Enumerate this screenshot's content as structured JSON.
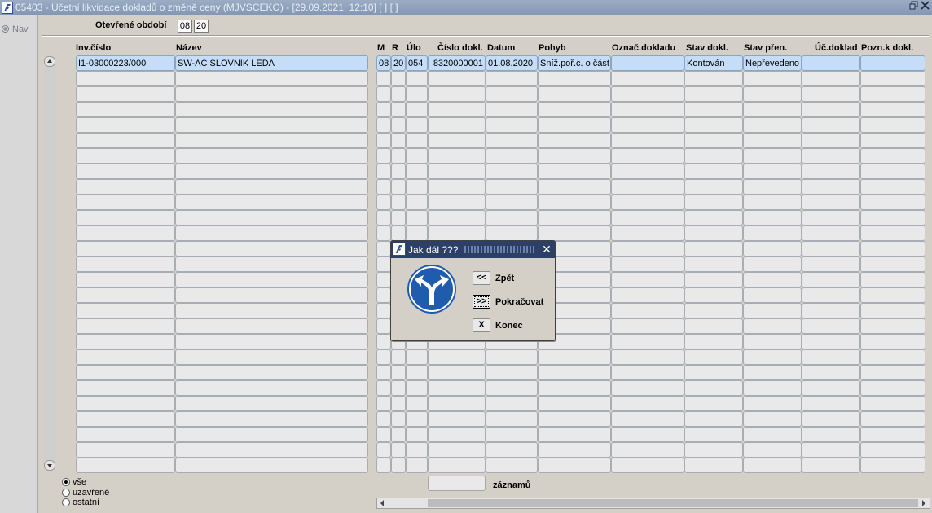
{
  "window": {
    "title": "05403 - Účetní likvidace dokladů o změně ceny (MJVSCEKO) - [29.09.2021; 12:10]  [ ]  [ ]"
  },
  "nav": {
    "label": "Nav"
  },
  "period": {
    "label": "Otevřené období",
    "month": "08",
    "year": "20"
  },
  "table": {
    "headers": [
      "Inv.číslo",
      "Název",
      "M",
      "R",
      "Úlo",
      "Číslo dokl.",
      "Datum",
      "Pohyb",
      "Označ.dokladu",
      "Stav dokl.",
      "Stav přen.",
      "Úč.doklad",
      "Pozn.k dokl."
    ],
    "rows": [
      [
        "I1-03000223/000",
        "SW-AC SLOVNIK LEDA",
        "08",
        "20",
        "054",
        "8320000001",
        "01.08.2020",
        "Sníž.poř.c. o část",
        "",
        "Kontován",
        "Nepřevedeno",
        "",
        ""
      ]
    ],
    "empty_row_count": 26
  },
  "filter": {
    "options": [
      {
        "label": "vše",
        "checked": true
      },
      {
        "label": "uzavřené",
        "checked": false
      },
      {
        "label": "ostatní",
        "checked": false
      }
    ]
  },
  "footer": {
    "count_label": "záznamů",
    "count_value": ""
  },
  "dialog": {
    "title": "Jak dál ???",
    "buttons": [
      {
        "symbol": "<<",
        "label": "Zpět",
        "focused": false
      },
      {
        "symbol": ">>",
        "label": "Pokračovat",
        "focused": true
      },
      {
        "symbol": "X",
        "label": "Konec",
        "focused": false
      }
    ],
    "icon": "fork-direction-sign-icon"
  },
  "colors": {
    "selected_row": "#c5ddf7",
    "dialog_title": "#2c3f66",
    "sign_blue": "#1f5cae"
  }
}
